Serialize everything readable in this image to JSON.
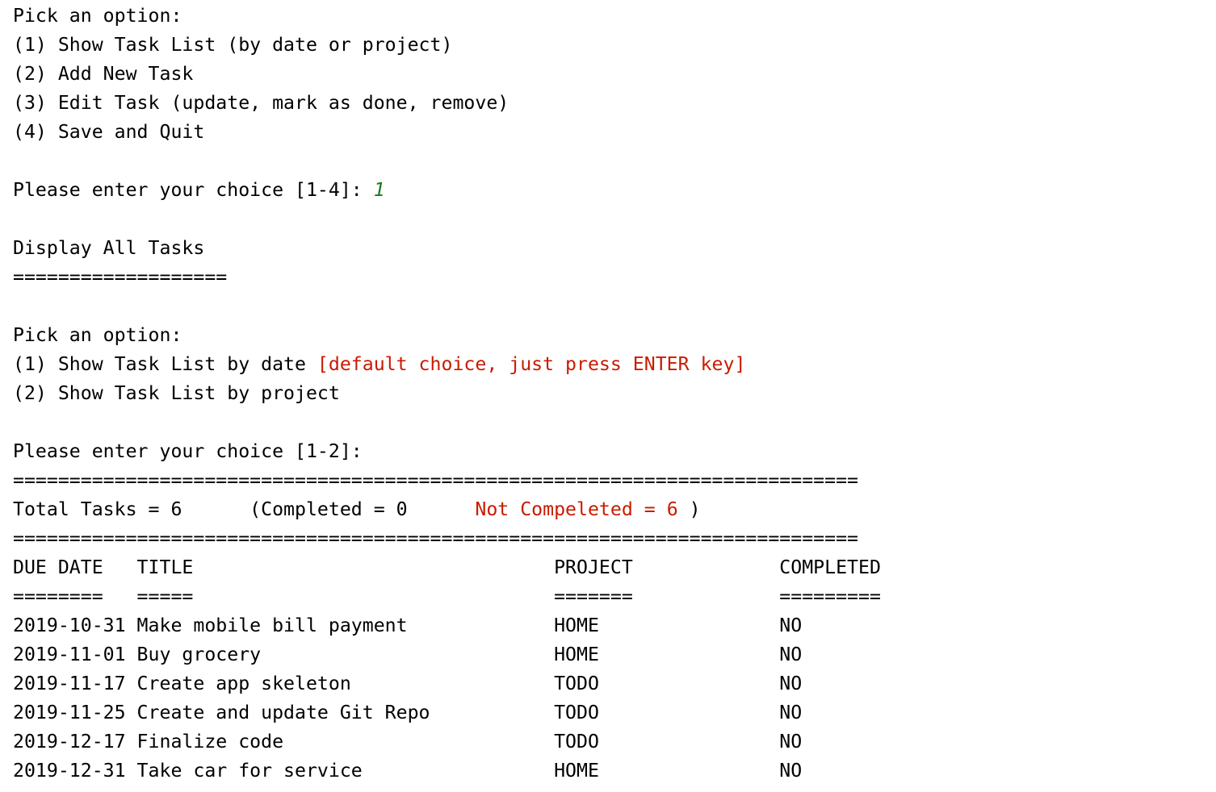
{
  "colors": {
    "text": "#000000",
    "highlight_red": "#c91b00",
    "input_green": "#1a7a1a",
    "background": "#ffffff"
  },
  "main_menu": {
    "prompt": "Pick an option:",
    "options": [
      "(1) Show Task List (by date or project)",
      "(2) Add New Task",
      "(3) Edit Task (update, mark as done, remove)",
      "(4) Save and Quit"
    ],
    "choice_prompt": "Please enter your choice [1-4]: ",
    "choice_value": "1"
  },
  "display": {
    "heading": "Display All Tasks",
    "underline": "==================="
  },
  "sub_menu": {
    "prompt": "Pick an option:",
    "option1": "(1) Show Task List by date ",
    "option1_hint": "[default choice, just press ENTER key]",
    "option2": "(2) Show Task List by project",
    "choice_prompt": "Please enter your choice [1-2]:"
  },
  "summary": {
    "rule": "===========================================================================",
    "total": "Total Tasks = 6      (Completed = 0      ",
    "not_completed": "Not Compeleted = 6",
    "close": " )"
  },
  "table": {
    "header": "DUE DATE   TITLE                                PROJECT             COMPLETED",
    "header_underline": "========   =====                                =======             =========",
    "rows": [
      "2019-10-31 Make mobile bill payment             HOME                NO",
      "2019-11-01 Buy grocery                          HOME                NO",
      "2019-11-17 Create app skeleton                  TODO                NO",
      "2019-11-25 Create and update Git Repo           TODO                NO",
      "2019-12-17 Finalize code                        TODO                NO",
      "2019-12-31 Take car for service                 HOME                NO"
    ]
  }
}
